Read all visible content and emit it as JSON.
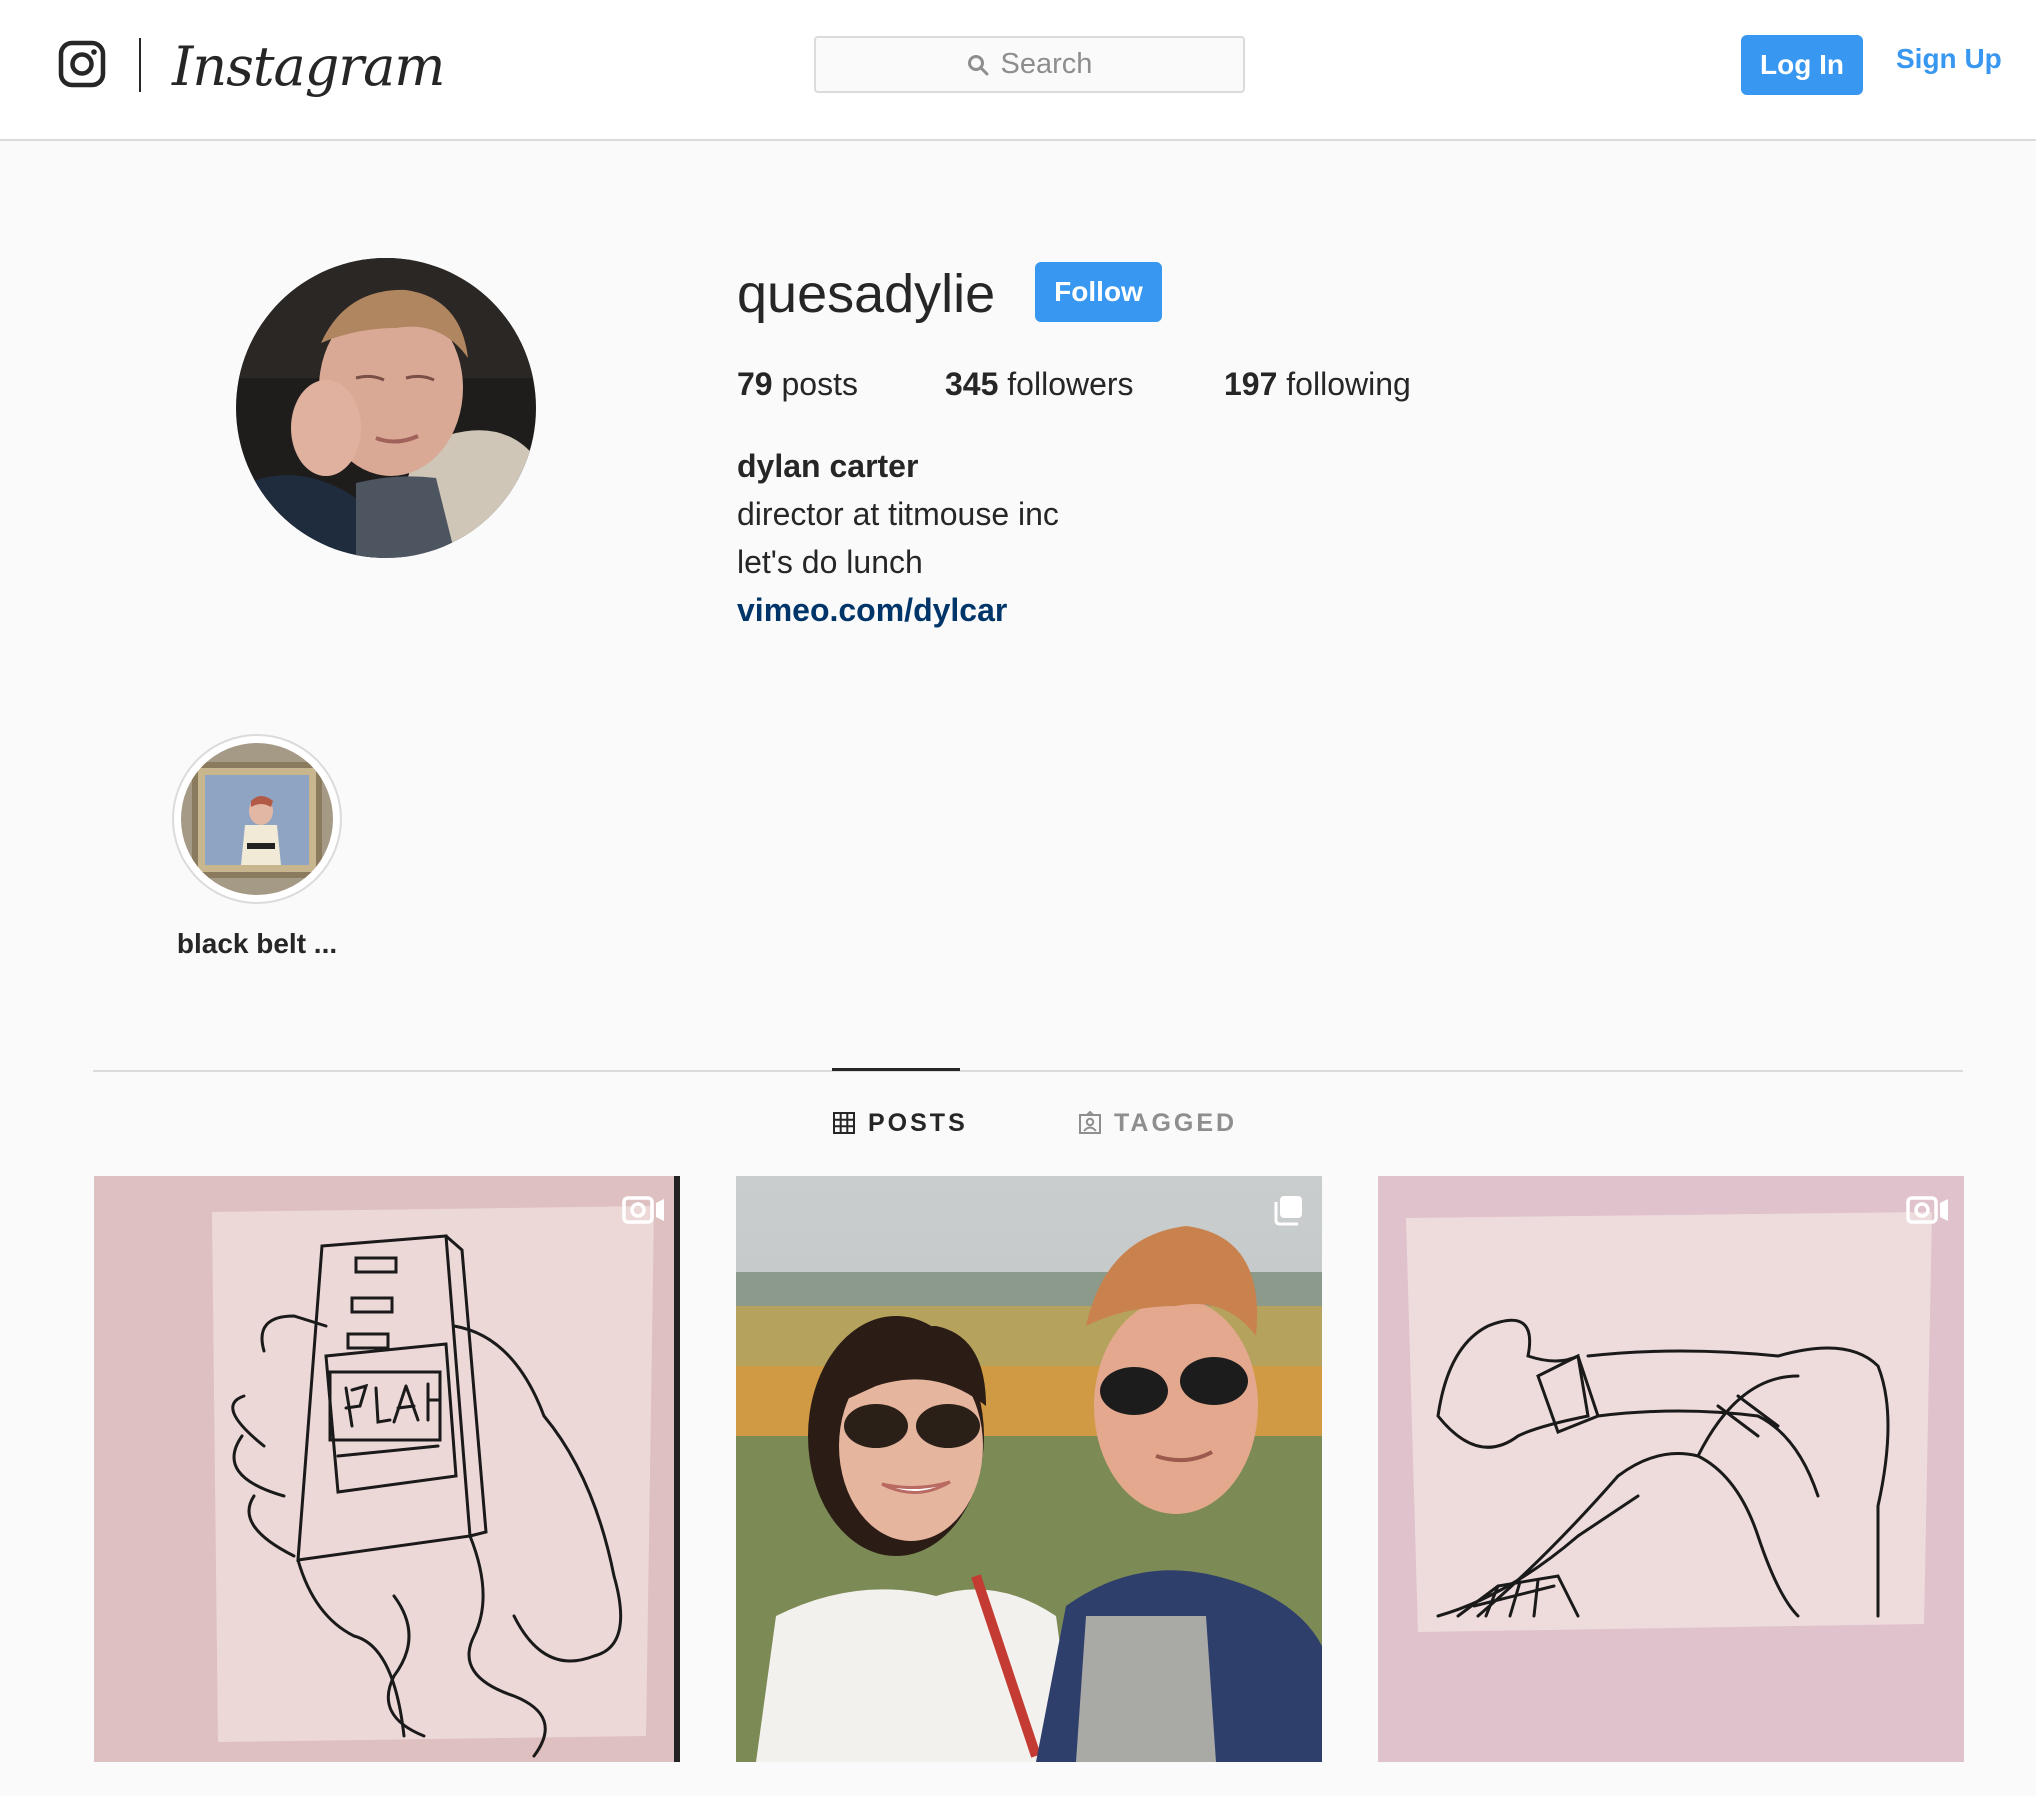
{
  "header": {
    "wordmark": "Instagram",
    "search_placeholder": "Search",
    "login_label": "Log In",
    "signup_label": "Sign Up"
  },
  "profile": {
    "username": "quesadylie",
    "follow_label": "Follow",
    "stats": [
      {
        "count": "79",
        "label": "posts"
      },
      {
        "count": "345",
        "label": "followers"
      },
      {
        "count": "197",
        "label": "following"
      }
    ],
    "full_name": "dylan carter",
    "bio_lines": [
      "director at titmouse inc",
      "let's do lunch"
    ],
    "link": "vimeo.com/dylcar"
  },
  "highlights": [
    {
      "label": "black belt ..."
    }
  ],
  "tabs": [
    {
      "label": "POSTS",
      "icon": "grid-icon",
      "active": true
    },
    {
      "label": "TAGGED",
      "icon": "tagged-icon",
      "active": false
    }
  ],
  "posts": [
    {
      "type": "video",
      "icon": "video-icon",
      "description": "phone drawing with blah text"
    },
    {
      "type": "carousel",
      "icon": "carousel-icon",
      "description": "selfie of two people with sunglasses"
    },
    {
      "type": "video",
      "icon": "video-icon",
      "description": "sketch of crossed legs"
    }
  ],
  "colors": {
    "accent": "#3897f0",
    "link": "#003569",
    "background": "#fafafa",
    "border": "#dbdbdb",
    "text": "#262626"
  }
}
